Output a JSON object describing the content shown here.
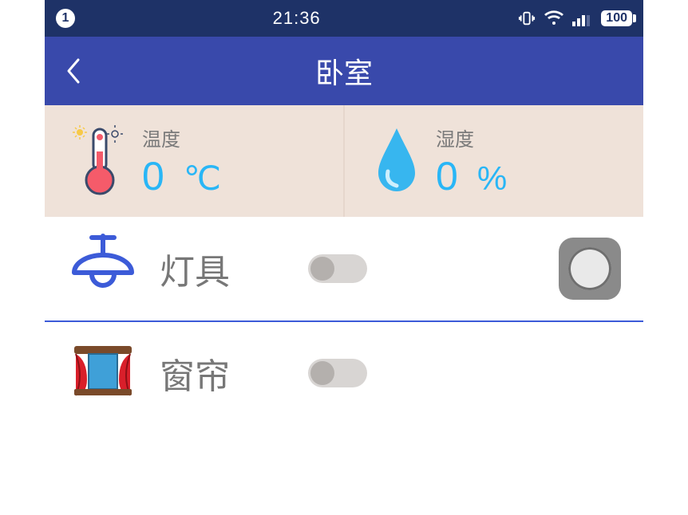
{
  "status": {
    "notification_count": "1",
    "time": "21:36",
    "battery": "100"
  },
  "header": {
    "title": "卧室"
  },
  "sensors": {
    "temperature": {
      "label": "温度",
      "value": "0",
      "unit": "℃"
    },
    "humidity": {
      "label": "湿度",
      "value": "0",
      "unit": "%"
    }
  },
  "devices": [
    {
      "id": "light",
      "label": "灯具",
      "on": false
    },
    {
      "id": "curtain",
      "label": "窗帘",
      "on": false
    }
  ]
}
